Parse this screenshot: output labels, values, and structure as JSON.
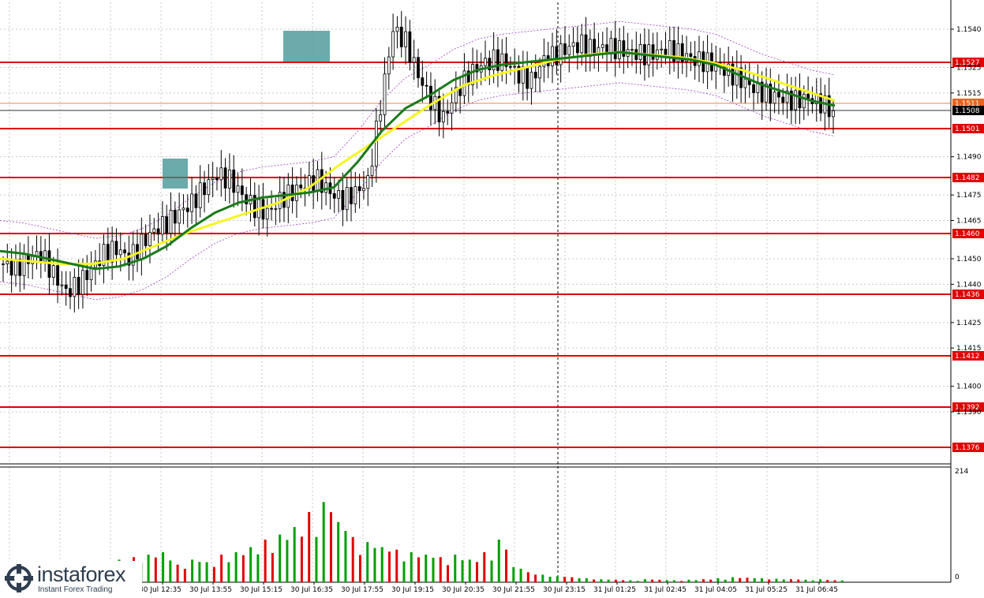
{
  "chart_data": {
    "type": "candlestick",
    "price_axis": {
      "ticks": [
        "1.1540",
        "1.1525",
        "1.1515",
        "1.1490",
        "1.1475",
        "1.1465",
        "1.1450",
        "1.1440",
        "1.1425",
        "1.1415",
        "1.1400",
        "1.1390"
      ],
      "tick_values": [
        1.154,
        1.1525,
        1.1515,
        1.149,
        1.1475,
        1.1465,
        1.145,
        1.144,
        1.1425,
        1.1415,
        1.14,
        1.139
      ],
      "range": [
        1.1369,
        1.155
      ]
    },
    "levels": [
      {
        "label": "1.1527",
        "value": 1.1527
      },
      {
        "label": "1.1501",
        "value": 1.1501
      },
      {
        "label": "1.1482",
        "value": 1.1482
      },
      {
        "label": "1.1460",
        "value": 1.146
      },
      {
        "label": "1.1436",
        "value": 1.1436
      },
      {
        "label": "1.1412",
        "value": 1.1412
      },
      {
        "label": "1.1392",
        "value": 1.1392
      },
      {
        "label": "1.1376",
        "value": 1.1376
      }
    ],
    "current_prices": [
      {
        "label": "1.1511",
        "value": 1.1511,
        "color": "#e8641e"
      },
      {
        "label": "1.1508",
        "value": 1.1508,
        "color": "#000000"
      }
    ],
    "time_axis": {
      "labels": [
        "30 Jul 12:35",
        "30 Jul 13:55",
        "30 Jul 15:15",
        "30 Jul 16:35",
        "30 Jul 17:55",
        "30 Jul 19:15",
        "30 Jul 20:35",
        "30 Jul 21:55",
        "30 Jul 23:15",
        "31 Jul 01:25",
        "31 Jul 02:45",
        "31 Jul 04:05",
        "31 Jul 05:25",
        "31 Jul 06:45"
      ]
    },
    "volume_axis": {
      "ticks": [
        "214",
        "0"
      ],
      "max": 214
    },
    "close_path": [
      1.1448,
      1.1446,
      1.145,
      1.1452,
      1.1444,
      1.1437,
      1.144,
      1.1446,
      1.1452,
      1.1454,
      1.145,
      1.1456,
      1.1461,
      1.1464,
      1.1468,
      1.1472,
      1.1478,
      1.1483,
      1.1481,
      1.1475,
      1.147,
      1.1468,
      1.1473,
      1.1476,
      1.1479,
      1.1481,
      1.1476,
      1.1473,
      1.1476,
      1.148,
      1.151,
      1.154,
      1.1535,
      1.1522,
      1.1512,
      1.1505,
      1.1515,
      1.1522,
      1.1526,
      1.1528,
      1.1527,
      1.1522,
      1.152,
      1.1528,
      1.153,
      1.1533,
      1.1534,
      1.1532,
      1.1533,
      1.1532,
      1.1531,
      1.153,
      1.1531,
      1.1532,
      1.153,
      1.1528,
      1.1527,
      1.1525,
      1.1522,
      1.1519,
      1.1516,
      1.1514,
      1.1513,
      1.1512,
      1.1513,
      1.1511,
      1.1508
    ],
    "sma_green_path": [
      1.1453,
      1.1452,
      1.145,
      1.1448,
      1.1446,
      1.1447,
      1.145,
      1.1455,
      1.1462,
      1.1468,
      1.1472,
      1.1474,
      1.1475,
      1.1476,
      1.1478,
      1.1488,
      1.15,
      1.1509,
      1.1514,
      1.152,
      1.1524,
      1.1526,
      1.1527,
      1.1528,
      1.1529,
      1.153,
      1.1531,
      1.153,
      1.1529,
      1.1528,
      1.1526,
      1.1522,
      1.1518,
      1.1515,
      1.1512,
      1.151
    ],
    "sma_yellow_path": [
      1.145,
      1.1449,
      1.1448,
      1.1448,
      1.145,
      1.1455,
      1.146,
      1.1464,
      1.1468,
      1.1472,
      1.1478,
      1.1487,
      1.1495,
      1.1503,
      1.1511,
      1.1518,
      1.1522,
      1.1525,
      1.1528,
      1.153,
      1.1531,
      1.153,
      1.1529,
      1.1527,
      1.1524,
      1.152,
      1.1516,
      1.1512
    ],
    "volume": [
      40,
      15,
      20,
      25,
      30,
      35,
      45,
      50,
      55,
      60,
      35,
      45,
      40,
      55,
      60,
      70,
      85,
      95,
      110,
      140,
      160,
      120,
      90,
      80,
      70,
      65,
      60,
      55,
      50,
      55,
      45,
      60,
      85,
      30,
      20,
      15,
      12,
      10,
      8,
      6,
      5,
      4,
      6,
      5,
      4,
      5,
      6,
      8,
      10,
      9,
      8,
      7,
      6,
      5,
      6,
      4
    ]
  }
}
